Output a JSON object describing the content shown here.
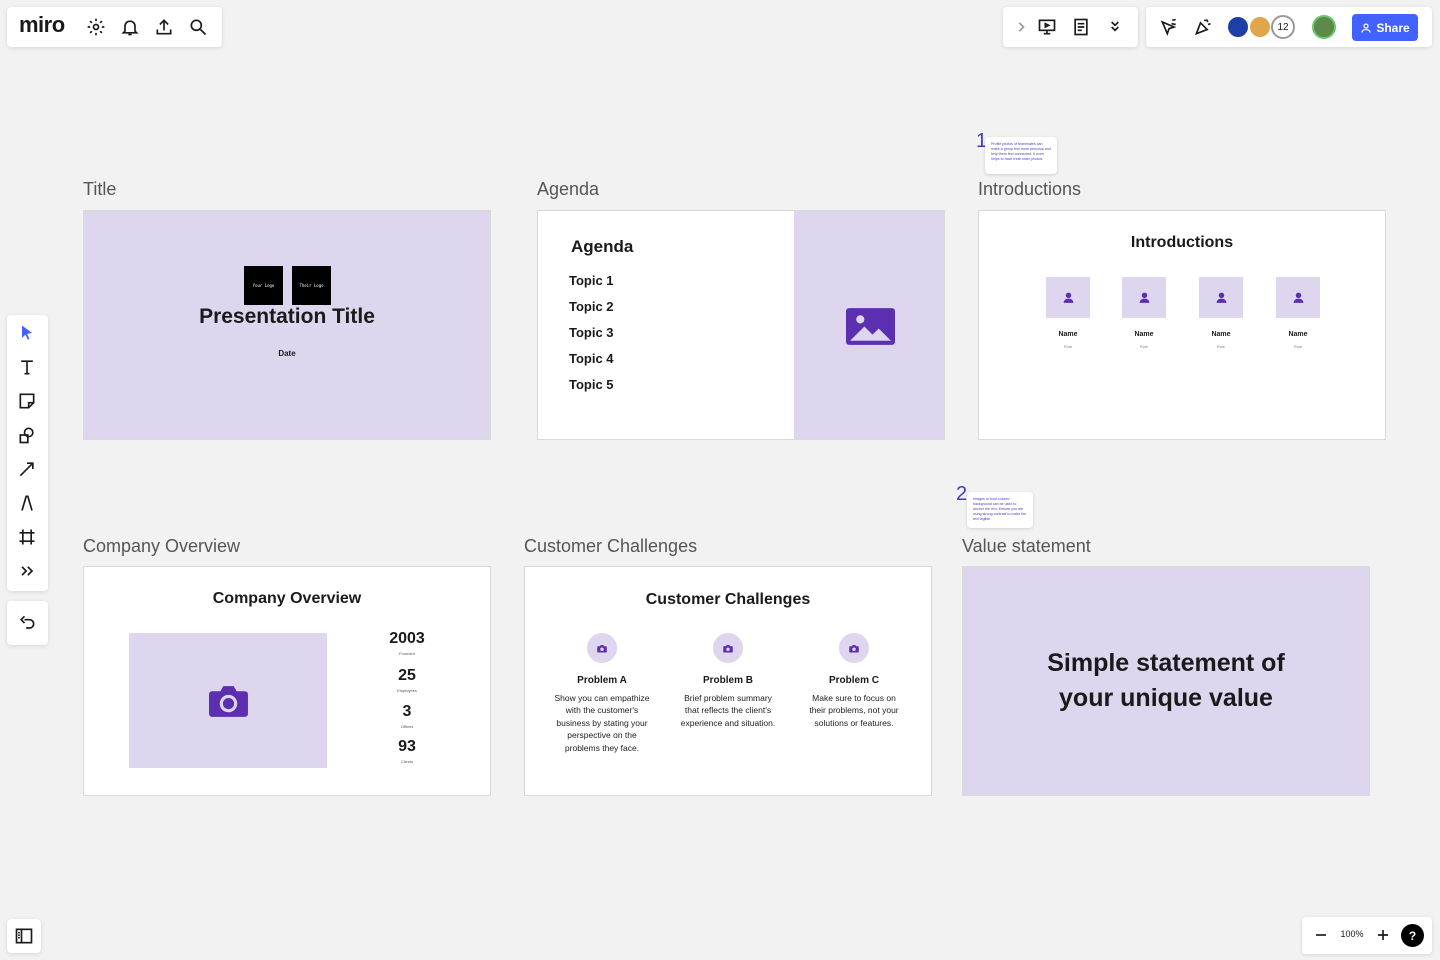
{
  "app": {
    "logo": "miro"
  },
  "topbar": {
    "icons": [
      "gear-icon",
      "bell-icon",
      "upload-icon",
      "search-icon"
    ],
    "share_label": "Share",
    "collaborator_count": "12"
  },
  "frames": {
    "title": {
      "label": "Title",
      "logo_left": "Your Logo",
      "logo_right": "Their Logo",
      "heading": "Presentation Title",
      "date": "Date"
    },
    "agenda": {
      "label": "Agenda",
      "heading": "Agenda",
      "topics": [
        "Topic 1",
        "Topic 2",
        "Topic 3",
        "Topic 4",
        "Topic 5"
      ]
    },
    "introductions": {
      "label": "Introductions",
      "heading": "Introductions",
      "people": [
        {
          "name": "Name",
          "role": "Role"
        },
        {
          "name": "Name",
          "role": "Role"
        },
        {
          "name": "Name",
          "role": "Role"
        },
        {
          "name": "Name",
          "role": "Role"
        }
      ]
    },
    "company_overview": {
      "label": "Company Overview",
      "heading": "Company Overview",
      "stats": [
        {
          "value": "2003",
          "label": "Founded"
        },
        {
          "value": "25",
          "label": "Employees"
        },
        {
          "value": "3",
          "label": "Offices"
        },
        {
          "value": "93",
          "label": "Clients"
        }
      ]
    },
    "customer_challenges": {
      "label": "Customer Challenges",
      "heading": "Customer Challenges",
      "problems": [
        {
          "title": "Problem A",
          "desc": "Show you can empathize with the customer's business by stating your perspective on the problems they face."
        },
        {
          "title": "Problem B",
          "desc": "Brief problem summary that reflects the client's experience and situation."
        },
        {
          "title": "Problem C",
          "desc": "Make sure to focus on their problems, not your solutions or features."
        }
      ]
    },
    "value_statement": {
      "label": "Value statement",
      "line1": "Simple statement of",
      "line2": "your unique value"
    }
  },
  "notes": [
    {
      "number": "1",
      "text": "Profile photos of teammates can make a group feel more personal and help them feel connected. It even helps to have fresh team photos."
    },
    {
      "number": "2",
      "text": "Images or bold colored background can be used to anchor the text. Ensure you are using strong contrast to make the text legible."
    }
  ],
  "bottom": {
    "zoom": "100%",
    "help": "?"
  },
  "colors": {
    "accent": "#4262ff",
    "lavender": "#ddd6ee",
    "purple": "#5b2fb0"
  }
}
